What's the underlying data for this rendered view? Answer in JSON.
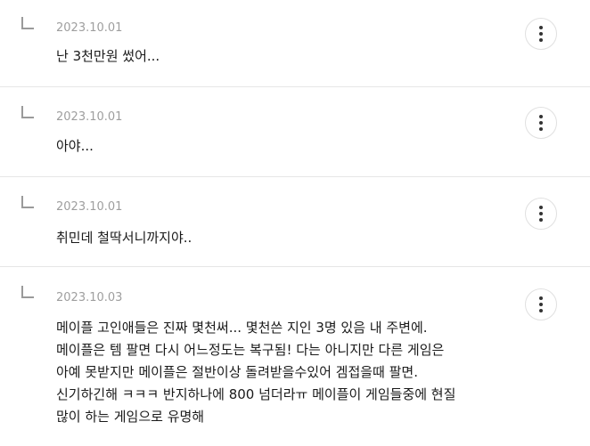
{
  "comments": [
    {
      "date": "2023.10.01",
      "lines": [
        "난 3천만원 썼어..."
      ]
    },
    {
      "date": "2023.10.01",
      "lines": [
        "아야..."
      ]
    },
    {
      "date": "2023.10.01",
      "lines": [
        "취민데 철딱서니까지야.."
      ]
    },
    {
      "date": "2023.10.03",
      "lines": [
        "메이플 고인애들은 진짜 몇천써... 몇천쓴 지인 3명 있음 내 주변에.",
        "메이플은 템 팔면 다시 어느정도는 복구됨! 다는 아니지만 다른 게임은",
        "아예 못받지만 메이플은 절반이상 돌려받을수있어 겜접을때 팔면.",
        "신기하긴해 ㅋㅋㅋ 반지하나에 800 넘더라ㅠ 메이플이 게임들중에 현질",
        "많이 하는 게임으로 유명해"
      ]
    }
  ]
}
